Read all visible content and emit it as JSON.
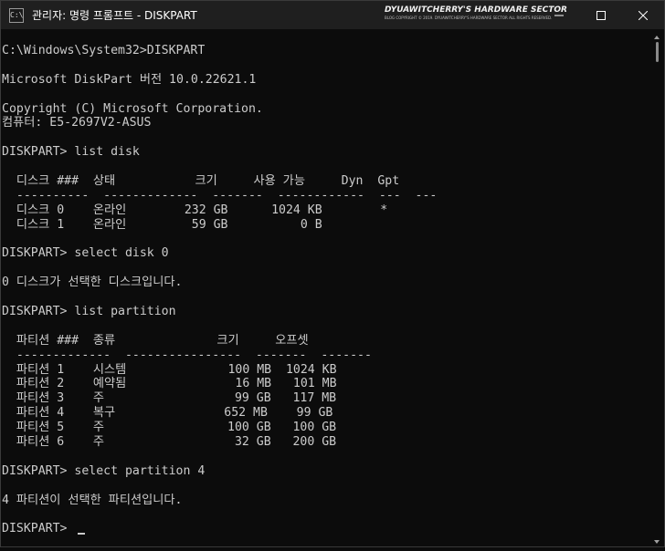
{
  "window": {
    "title": "관리자: 명령 프롬프트 - DISKPART",
    "app_icon_text": "C:\\"
  },
  "watermark": {
    "title": "DYUAWITCHERRY'S HARDWARE SECTOR",
    "subtitle": "BLOG COPYRIGHT © 2019. DYUAWITCHERRY'S HARDWARE SECTOR ALL RIGHTS RESERVED."
  },
  "terminal": {
    "lines": [
      "C:\\Windows\\System32>DISKPART",
      "",
      "Microsoft DiskPart 버전 10.0.22621.1",
      "",
      "Copyright (C) Microsoft Corporation.",
      "컴퓨터: E5-2697V2-ASUS",
      "",
      "DISKPART> list disk",
      "",
      "  디스크 ###  상태           크기     사용 가능     Dyn  Gpt",
      "  ----------  -------------  -------  ------------  ---  ---",
      "  디스크 0    온라인        232 GB      1024 KB        *",
      "  디스크 1    온라인         59 GB          0 B",
      "",
      "DISKPART> select disk 0",
      "",
      "0 디스크가 선택한 디스크입니다.",
      "",
      "DISKPART> list partition",
      "",
      "  파티션 ###  종류              크기     오프셋",
      "  -------------  ----------------  -------  -------",
      "  파티션 1    시스템              100 MB  1024 KB",
      "  파티션 2    예약됨               16 MB   101 MB",
      "  파티션 3    주                  99 GB   117 MB",
      "  파티션 4    복구               652 MB    99 GB",
      "  파티션 5    주                 100 GB   100 GB",
      "  파티션 6    주                  32 GB   200 GB",
      "",
      "DISKPART> select partition 4",
      "",
      "4 파티션이 선택한 파티션입니다.",
      "",
      "DISKPART> "
    ]
  }
}
